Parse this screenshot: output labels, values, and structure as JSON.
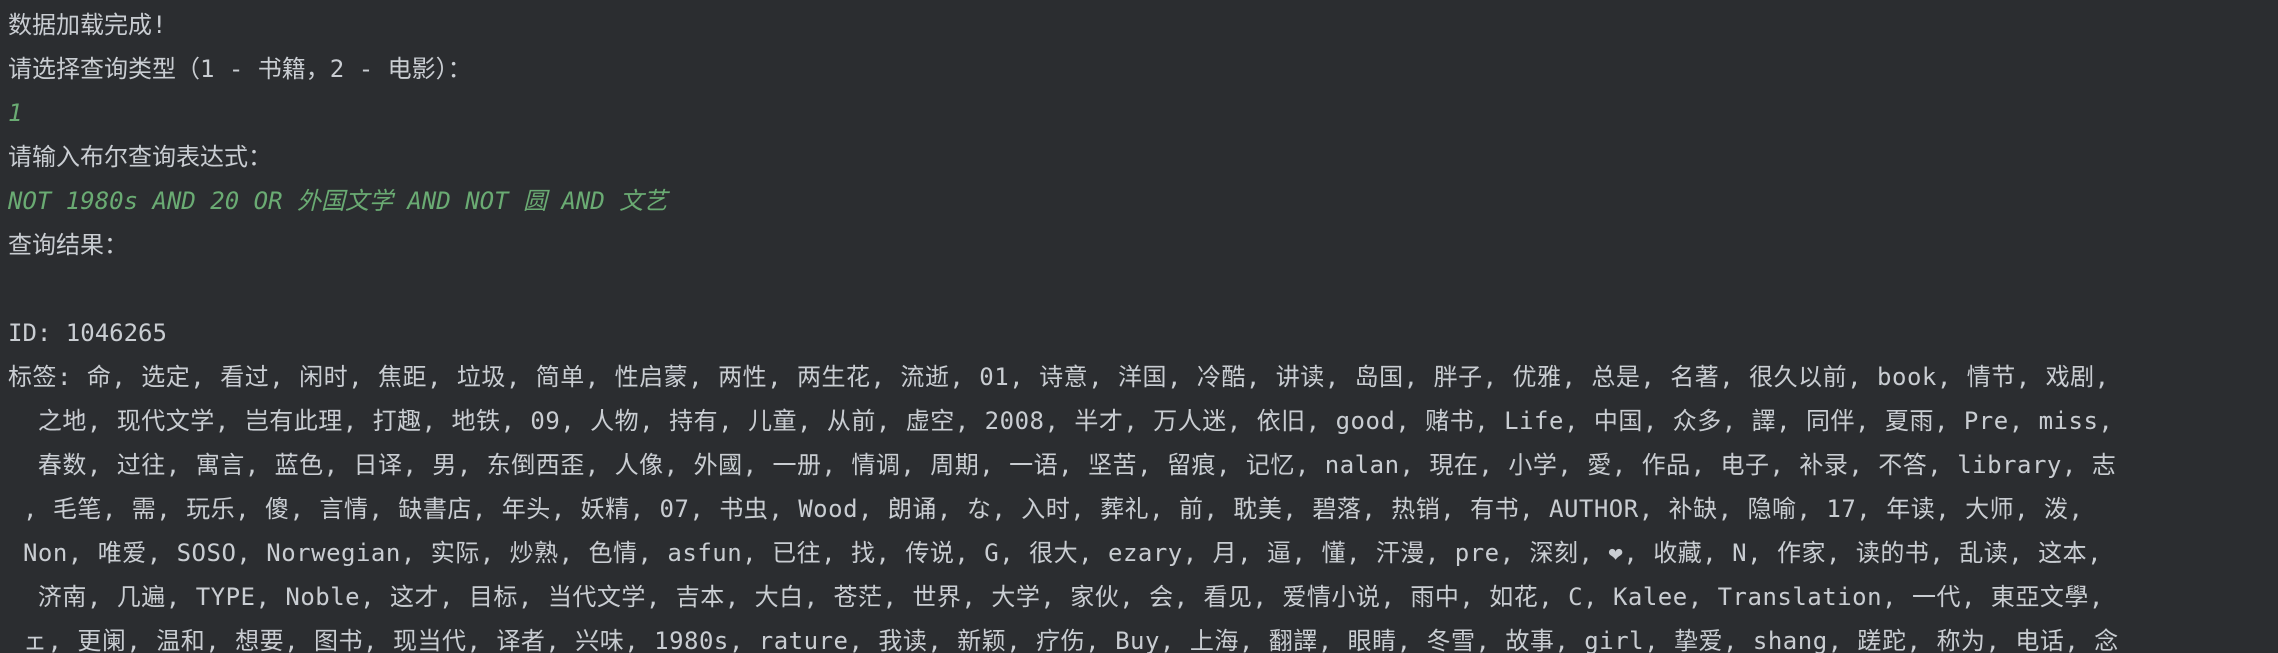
{
  "console": {
    "loaded_msg": "数据加载完成!",
    "type_prompt": "请选择查询类型（1 - 书籍，2 - 电影）：",
    "type_input": "1",
    "expr_prompt": "请输入布尔查询表达式：",
    "expr_input": "NOT 1980s AND 20 OR 外国文学 AND NOT 圆 AND 文艺",
    "result_header": "查询结果：",
    "blank": "",
    "id_line": "ID: 1046265",
    "tag_lines": [
      "标签: 命, 选定, 看过, 闲时, 焦距, 垃圾, 简单, 性启蒙, 两性, 两生花, 流逝, 01, 诗意, 洋国, 冷酷, 讲读, 岛国, 胖子, 优雅, 总是, 名著, 很久以前, book, 情节, 戏剧,",
      "  之地, 现代文学, 岂有此理, 打趣, 地铁, 09, 人物, 持有, 儿童, 从前, 虚空, 2008, 半才, 万人迷, 依旧, good, 赌书, Life, 中国, 众多, 譯, 同伴, 夏雨, Pre, miss,",
      "  春数, 过往, 寓言, 蓝色, 日译, 男, 东倒西歪, 人像, 外國, 一册, 情调, 周期, 一语, 坚苦, 留痕, 记忆, nalan, 現在, 小学, 愛, 作品, 电子, 补录, 不答, library, 志",
      " , 毛笔, 需, 玩乐, 傻, 言情, 缺書店, 年头, 妖精, 07, 书虫, Wood, 朗诵, な, 入时, 葬礼, 前, 耽美, 碧落, 热销, 有书, AUTHOR, 补缺, 隐喻, 17, 年读, 大师, 泼,",
      " Non, 唯爱, SOSO, Norwegian, 实际, 炒熟, 色情, asfun, 已往, 找, 传说, G, 很大, ezary, 月, 逼, 懂, 汗漫, pre, 深刻, ❤, 收藏, N, 作家, 读的书, 乱读, 这本,",
      "  济南, 几遍, TYPE, Noble, 这才, 目标, 当代文学, 吉本, 大白, 苍茫, 世界, 大学, 家伙, 会, 看见, 爱情小说, 雨中, 如花, C, Kalee, Translation, 一代, 東亞文學,",
      " ェ, 更阑, 温和, 想要, 图书, 现当代, 译者, 兴味, 1980s, rature, 我读, 新颖, 疗伤, Buy, 上海, 翻譯, 眼睛, 冬雪, 故事, girl, 挚爱, shang, 蹉跎, 称为, 电话, 念"
    ]
  }
}
